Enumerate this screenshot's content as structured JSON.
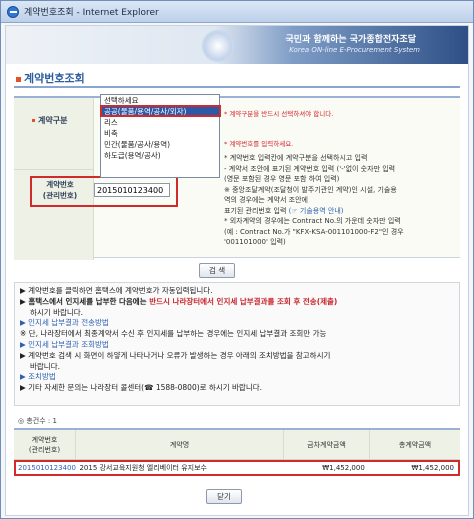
{
  "window": {
    "title": "계약번호조회 - Internet Explorer"
  },
  "header": {
    "slogan": "국민과 함께하는 국가종합전자조달",
    "system_name": "Korea ON-line E-Procurement System"
  },
  "page": {
    "title": "계약번호조회"
  },
  "form": {
    "contract_type_label": "계약구분",
    "contract_type_options": [
      "선택하세요",
      "공공(물품/용역/공사/외자)",
      "리스",
      "비축",
      "민간(물품/공사/용역)",
      "하도급(용역/공사)"
    ],
    "contract_type_selected": "공공(물품/용역/공사/외자)",
    "hint_red1": "* 계약구분을 반드시 선택하셔야 합니다.",
    "hint_red2": "* 계약번호를 입력하세요.",
    "hints": [
      "* 계약번호 입력칸에 계약구분을 선택하시고 입력",
      "- 계약서 조안에 표기된 계약번호 입력 ('-'없이 숫자만 입력",
      "(영문 포함된 경우 영문 포함 하여 입력)",
      "※ 중앙조달계약(조달청이 발주기관인 계약)인 시설, 기술용",
      "역의 경우에는 계약서 조안에",
      "표기된 관리번호 입력"
    ],
    "hint_link": "(☞ 기술용역 안내)",
    "hints2": [
      "* 외자계약의 경우에는 Contract No.의 가운데 숫자만 입력",
      "(예 : Contract No.가 \"KFX-KSA-001101000-F2\"인 경우",
      "'001101000' 입력)"
    ],
    "contract_no_label": "계약번호\n(관리번호)",
    "contract_no_value": "2015010123400",
    "search_button": "검 색"
  },
  "notice": {
    "line1": "▶ 계약번호를 클릭하면 홈택스에 계약번호가 자동입력됩니다.",
    "line2a": "▶ 홈택스에서 인지세를 납부한 다음에는 ",
    "line2b": "반드시 나라장터에서 인지세 납부결과를 조회 후 전송(제출)",
    "line2c": "하시기 바랍니다.",
    "link1": "▶ 인지세 납부결과 전송방법",
    "line3": "※ 단, 나라장터에서 최종계약서 수신 후 인지세를 납부하는 경우에는 인지세 납부결과 조회만 가능",
    "link2": "▶ 인지세 납부결과 조회방법",
    "line4": "▶ 계약번호 검색 시 화면이 하얗게 나타나거나 오류가 발생하는 경우 아래의 조치방법을 참고하시기",
    "line4b": "바랍니다.",
    "link3": "▶ 조치방법",
    "line5": "▶ 기타 자세한 문의는 나라장터 콜센터(☎ 1588-0800)로 하시기 바랍니다."
  },
  "results": {
    "count_label": "◎ 총건수 : 1",
    "columns": [
      "계약번호\n(관리번호)",
      "계약명",
      "금차계약금액",
      "총계약금액"
    ],
    "rows": [
      {
        "contract_no": "2015010123400",
        "name": "2015 강서교육지원청 엘리베이터 유지보수",
        "current_amount": "₩1,452,000",
        "total_amount": "₩1,452,000"
      }
    ]
  },
  "close_button": "닫기"
}
